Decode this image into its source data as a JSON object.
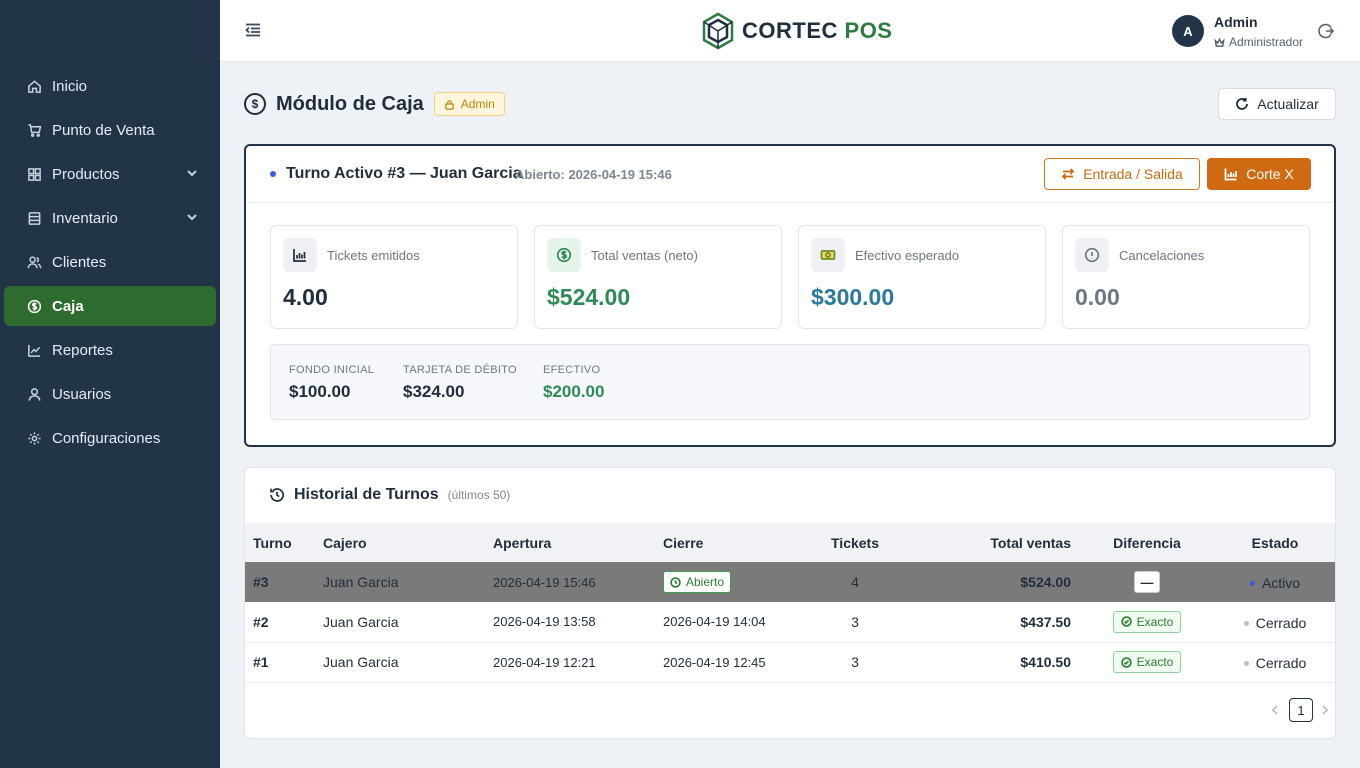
{
  "app": {
    "brand_main": "CORTEC",
    "brand_accent": "POS"
  },
  "sidebar": {
    "items": [
      {
        "label": "Inicio",
        "icon": "home-icon"
      },
      {
        "label": "Punto de Venta",
        "icon": "cart-icon"
      },
      {
        "label": "Productos",
        "icon": "grid-icon",
        "expandable": true
      },
      {
        "label": "Inventario",
        "icon": "inventory-icon",
        "expandable": true
      },
      {
        "label": "Clientes",
        "icon": "users-icon"
      },
      {
        "label": "Caja",
        "icon": "dollar-circle-icon",
        "active": true
      },
      {
        "label": "Reportes",
        "icon": "chart-line-icon"
      },
      {
        "label": "Usuarios",
        "icon": "user-icon"
      },
      {
        "label": "Configuraciones",
        "icon": "gear-icon"
      }
    ]
  },
  "header": {
    "avatar_letter": "A",
    "user_name": "Admin",
    "user_role": "Administrador"
  },
  "page": {
    "icon_glyph": "$",
    "title": "Módulo de Caja",
    "badge": "Admin",
    "refresh_label": "Actualizar"
  },
  "shift": {
    "title": "Turno Activo #3 — Juan Garcia",
    "opened": "Abierto: 2026-04-19 15:46",
    "btn_io": "Entrada / Salida",
    "btn_cut": "Corte X",
    "stats": [
      {
        "label": "Tickets emitidos",
        "value": "4.00",
        "color": "#1f2d3d",
        "icon": "bar-chart-icon"
      },
      {
        "label": "Total ventas (neto)",
        "value": "$524.00",
        "color": "#2e8b57",
        "icon": "dollar-icon"
      },
      {
        "label": "Efectivo esperado",
        "value": "$300.00",
        "color": "#2b7a9b",
        "icon": "cash-icon"
      },
      {
        "label": "Cancelaciones",
        "value": "0.00",
        "color": "#6b7784",
        "icon": "info-icon"
      }
    ],
    "summary": [
      {
        "label": "FONDO INICIAL",
        "value": "$100.00",
        "color": "#1f2d3d"
      },
      {
        "label": "TARJETA DE DÉBITO",
        "value": "$324.00",
        "color": "#1f2d3d"
      },
      {
        "label": "EFECTIVO",
        "value": "$200.00",
        "color": "#2e8b57"
      }
    ]
  },
  "history": {
    "title": "Historial de Turnos",
    "subtitle": "(últimos 50)",
    "columns": [
      "Turno",
      "Cajero",
      "Apertura",
      "Cierre",
      "Tickets",
      "Total ventas",
      "Diferencia",
      "Estado"
    ],
    "rows": [
      {
        "turno": "#3",
        "cajero": "Juan Garcia",
        "apertura": "2026-04-19 15:46",
        "cierre": "Abierto",
        "tickets": "4",
        "total": "$524.00",
        "diferencia": "—",
        "estado": "Activo",
        "active": true
      },
      {
        "turno": "#2",
        "cajero": "Juan Garcia",
        "apertura": "2026-04-19 13:58",
        "cierre": "2026-04-19 14:04",
        "tickets": "3",
        "total": "$437.50",
        "diferencia": "Exacto",
        "estado": "Cerrado"
      },
      {
        "turno": "#1",
        "cajero": "Juan Garcia",
        "apertura": "2026-04-19 12:21",
        "cierre": "2026-04-19 12:45",
        "tickets": "3",
        "total": "$410.50",
        "diferencia": "Exacto",
        "estado": "Cerrado"
      }
    ],
    "page": "1"
  }
}
